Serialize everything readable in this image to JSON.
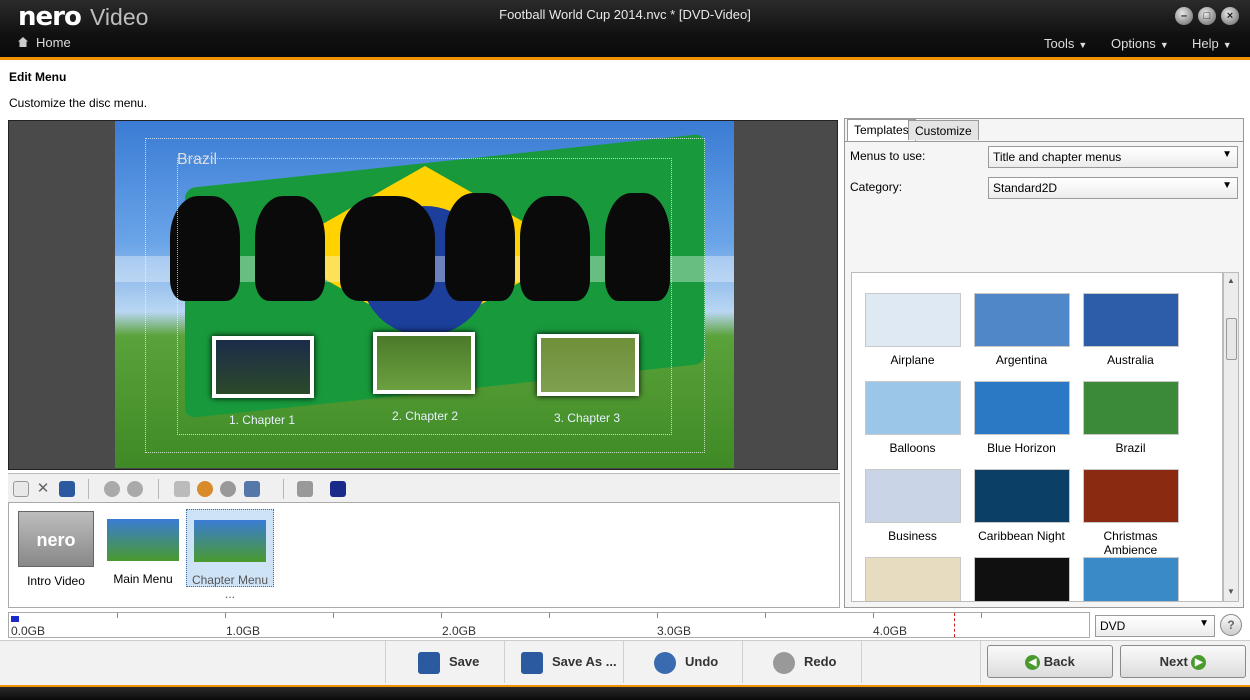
{
  "app": {
    "brand": "nero",
    "product": "Video",
    "window_title": "Football World Cup 2014.nvc * [DVD-Video]",
    "home_label": "Home",
    "menus": [
      "Tools",
      "Options",
      "Help"
    ]
  },
  "page": {
    "title": "Edit Menu",
    "subtitle": "Customize the disc menu."
  },
  "preview": {
    "menu_title": "Brazil",
    "chapters": [
      "1. Chapter 1",
      "2. Chapter 2",
      "3. Chapter 3"
    ]
  },
  "menu_list": {
    "items": [
      {
        "label": "Intro Video",
        "thumb_text": "nero"
      },
      {
        "label": "Main Menu"
      },
      {
        "label": "Chapter Menu ...",
        "selected": true
      }
    ]
  },
  "right_panel": {
    "tabs": [
      "Templates",
      "Customize"
    ],
    "active_tab": "Templates",
    "menus_to_use_label": "Menus to use:",
    "menus_to_use_value": "Title and chapter menus",
    "category_label": "Category:",
    "category_value": "Standard2D",
    "templates": [
      {
        "name": "Airplane",
        "color": "#dfe9f3"
      },
      {
        "name": "Argentina",
        "color": "#4f87c9"
      },
      {
        "name": "Australia",
        "color": "#2d5da8"
      },
      {
        "name": "Balloons",
        "color": "#9cc6e8"
      },
      {
        "name": "Blue Horizon",
        "color": "#2b78c4"
      },
      {
        "name": "Brazil",
        "color": "#3a8a3a"
      },
      {
        "name": "Business",
        "color": "#c9d5e6"
      },
      {
        "name": "Caribbean Night",
        "color": "#0b3f66"
      },
      {
        "name": "Christmas Ambience",
        "color": "#8a2a10"
      }
    ]
  },
  "capacity": {
    "labels": [
      "0.0GB",
      "1.0GB",
      "2.0GB",
      "3.0GB",
      "4.0GB"
    ],
    "disc_type": "DVD",
    "used_fraction": 0.007
  },
  "buttons": {
    "save": "Save",
    "save_as": "Save As ...",
    "undo": "Undo",
    "redo": "Redo",
    "back": "Back",
    "next": "Next"
  },
  "colors": {
    "accent": "#f39200",
    "selection": "#cfe3f7"
  }
}
